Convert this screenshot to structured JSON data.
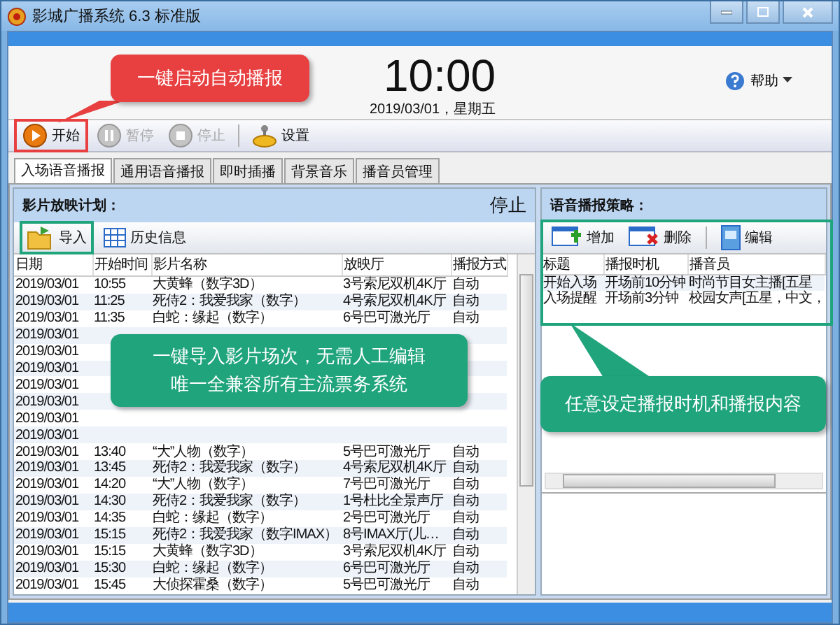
{
  "window": {
    "title": "影城广播系统 6.3 标准版"
  },
  "clock": {
    "time": "10:00",
    "date": "2019/03/01，星期五"
  },
  "help": {
    "label": "帮助"
  },
  "toolbar": [
    {
      "kind": "play",
      "label": "开始",
      "disabled": false
    },
    {
      "kind": "pause",
      "label": "暂停",
      "disabled": true
    },
    {
      "kind": "stop",
      "label": "停止",
      "disabled": true
    },
    {
      "kind": "settings",
      "label": "设置",
      "disabled": false
    }
  ],
  "tabs": [
    {
      "label": "入场语音播报",
      "selected": true
    },
    {
      "label": "通用语音播报",
      "selected": false
    },
    {
      "label": "即时插播",
      "selected": false
    },
    {
      "label": "背景音乐",
      "selected": false
    },
    {
      "label": "播音员管理",
      "selected": false
    }
  ],
  "schedule": {
    "title": "影片放映计划：",
    "status": "停止",
    "actions": [
      {
        "kind": "import",
        "label": "导入"
      },
      {
        "kind": "history",
        "label": "历史信息"
      }
    ],
    "columns": [
      "日期",
      "开始时间",
      "影片名称",
      "放映厅",
      "播报方式"
    ],
    "rows": [
      [
        "2019/03/01",
        "10:55",
        "大黄蜂（数字3D）",
        "3号索尼双机4K厅",
        "自动"
      ],
      [
        "2019/03/01",
        "11:25",
        "死侍2：我爱我家（数字）",
        "4号索尼双机4K厅",
        "自动"
      ],
      [
        "2019/03/01",
        "11:35",
        "白蛇：缘起（数字）",
        "6号巴可激光厅",
        "自动"
      ],
      [
        "2019/03/01"
      ],
      [
        "2019/03/01"
      ],
      [
        "2019/03/01"
      ],
      [
        "2019/03/01"
      ],
      [
        "2019/03/01"
      ],
      [
        "2019/03/01"
      ],
      [
        "2019/03/01"
      ],
      [
        "2019/03/01",
        "13:40",
        "“大”人物（数字）",
        "5号巴可激光厅",
        "自动"
      ],
      [
        "2019/03/01",
        "13:45",
        "死侍2：我爱我家（数字）",
        "4号索尼双机4K厅",
        "自动"
      ],
      [
        "2019/03/01",
        "14:20",
        "“大”人物（数字）",
        "7号巴可激光厅",
        "自动"
      ],
      [
        "2019/03/01",
        "14:30",
        "死侍2：我爱我家（数字）",
        "1号杜比全景声厅",
        "自动"
      ],
      [
        "2019/03/01",
        "14:35",
        "白蛇：缘起（数字）",
        "2号巴可激光厅",
        "自动"
      ],
      [
        "2019/03/01",
        "15:15",
        "死侍2：我爱我家（数字IMAX）",
        "8号IMAX厅(儿…",
        "自动"
      ],
      [
        "2019/03/01",
        "15:15",
        "大黄蜂（数字3D）",
        "3号索尼双机4K厅",
        "自动"
      ],
      [
        "2019/03/01",
        "15:30",
        "白蛇：缘起（数字）",
        "6号巴可激光厅",
        "自动"
      ],
      [
        "2019/03/01",
        "15:45",
        "大侦探霍桑（数字）",
        "5号巴可激光厅",
        "自动"
      ]
    ]
  },
  "strategy": {
    "title": "语音播报策略：",
    "actions": [
      {
        "kind": "add",
        "label": "增加"
      },
      {
        "kind": "delete",
        "label": "删除"
      },
      {
        "kind": "edit",
        "label": "编辑"
      }
    ],
    "columns": [
      "标题",
      "播报时机",
      "播音员"
    ],
    "rows": [
      [
        "开始入场",
        "开场前10分钟",
        "时尚节目女主播[五星"
      ],
      [
        "入场提醒",
        "开场前3分钟",
        "校园女声[五星，中文，"
      ]
    ]
  },
  "callouts": [
    {
      "kind": "red",
      "lines": [
        "一键启动自动播报"
      ]
    },
    {
      "kind": "green-middle",
      "lines": [
        "一键导入影片场次，无需人工编辑",
        "唯一全兼容所有主流票务系统"
      ]
    },
    {
      "kind": "green-right",
      "lines": [
        "任意设定播报时机和播报内容"
      ]
    }
  ]
}
